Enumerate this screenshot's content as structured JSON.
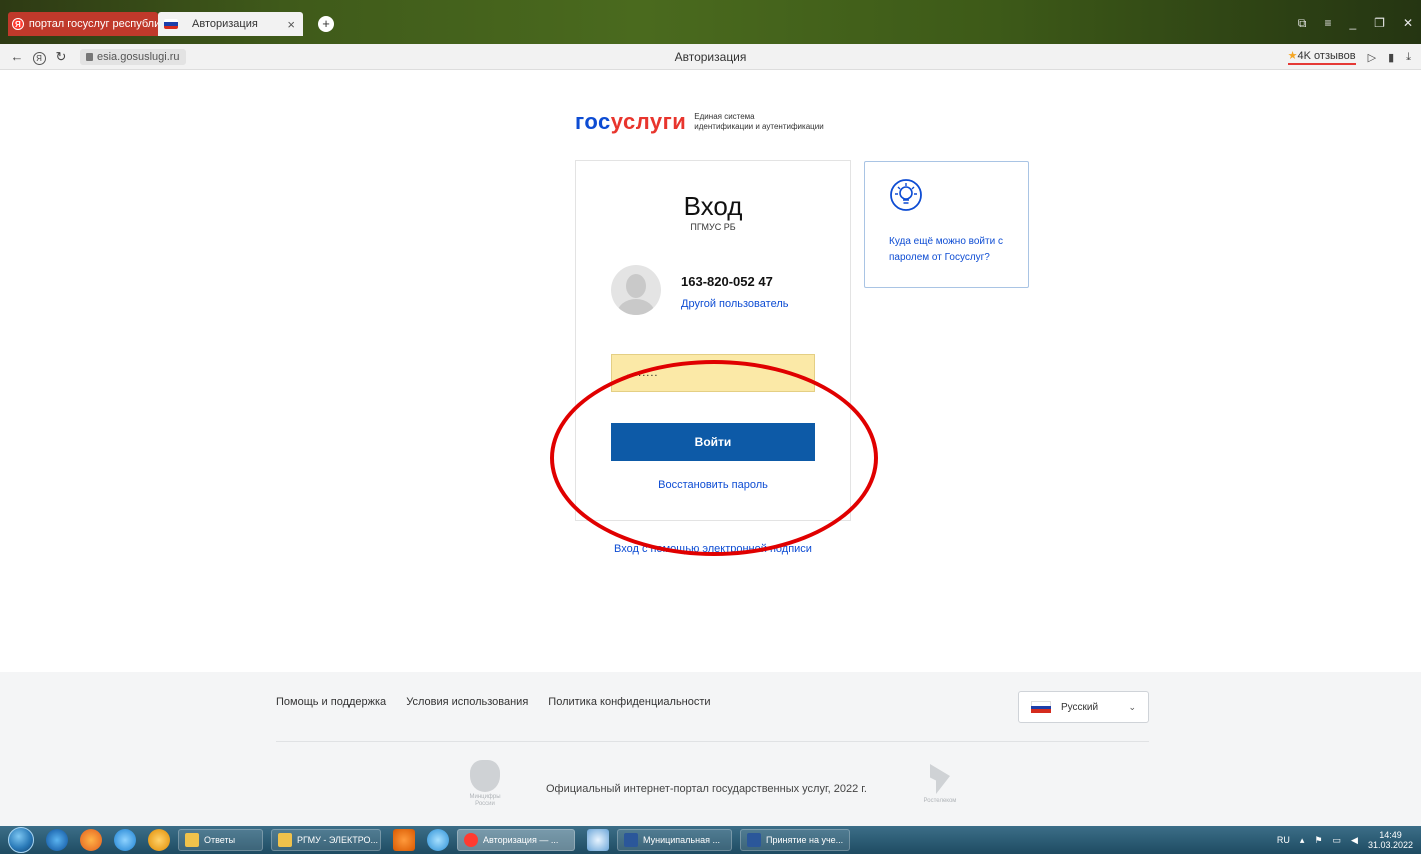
{
  "browser": {
    "tabs": [
      {
        "label": "портал госуслуг республи",
        "active": false
      },
      {
        "label": "Авторизация",
        "active": true
      }
    ],
    "new_tab_glyph": "+",
    "address": {
      "url": "esia.gosuslugi.ru",
      "page_title": "Авторизация",
      "reviews": "4K отзывов"
    }
  },
  "logo": {
    "word_part1": "гос",
    "word_part2": "услуги",
    "subtitle_line1": "Единая система",
    "subtitle_line2": "идентификации и аутентификации"
  },
  "login": {
    "title": "Вход",
    "subtitle": "ПГМУС РБ",
    "account_id": "163-820-052 47",
    "other_user_link": "Другой пользователь",
    "password_value": "........",
    "submit_label": "Войти",
    "forgot_label": "Восстановить пароль"
  },
  "ep_link": "Вход с помощью электронной подписи",
  "info_card": {
    "icon": "lightbulb-icon",
    "text": "Куда ещё можно войти с паролем от Госуслуг?"
  },
  "footer": {
    "links": [
      "Помощь и поддержка",
      "Условия использования",
      "Политика конфиденциальности"
    ],
    "language": "Русский",
    "copyright": "Официальный интернет-портал государственных услуг, 2022 г.",
    "emblem_caption_1": "Минцифры",
    "emblem_caption_2": "России",
    "partner_caption": "Ростелеком"
  },
  "taskbar": {
    "items": [
      {
        "label": "Ответы",
        "color": "#f0c24b"
      },
      {
        "label": "РГМУ - ЭЛЕКТРО...",
        "color": "#f0c24b"
      },
      {
        "label": "Авторизация — ...",
        "color": "#ff3b30"
      },
      {
        "label": "Муниципальная ...",
        "color": "#2b579a"
      },
      {
        "label": "Принятие на уче...",
        "color": "#2b579a"
      }
    ],
    "lang": "RU",
    "time": "14:49",
    "date": "31.03.2022"
  },
  "colors": {
    "brand_blue": "#0d4cd3",
    "brand_red": "#e8352d",
    "button_blue": "#0d5aa7",
    "autofill_yellow": "#fbe9a7",
    "annotation_red": "#e00000"
  }
}
